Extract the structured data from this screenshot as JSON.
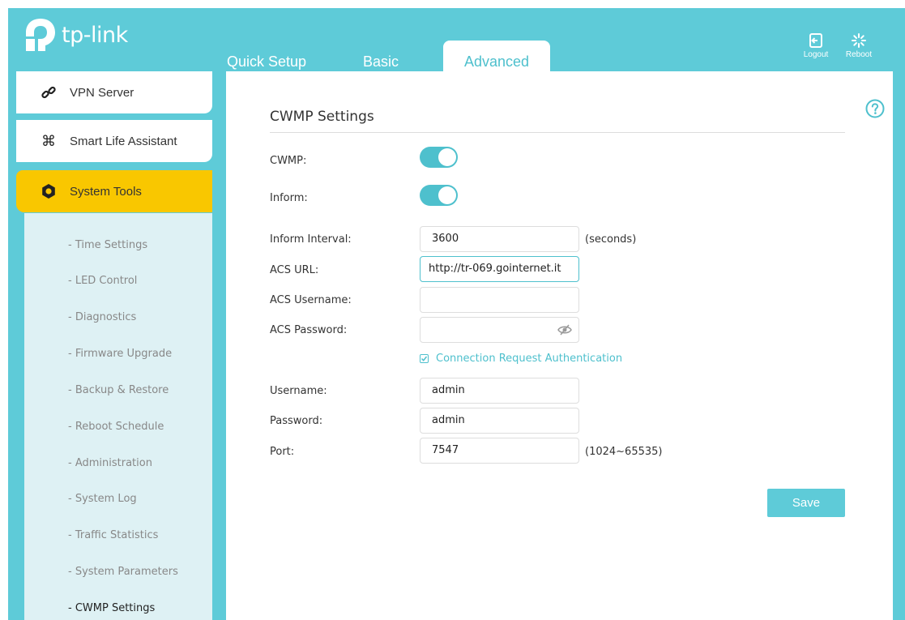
{
  "brand": {
    "name": "tp-link",
    "accent": "#4ec0cd",
    "header_bg": "#5ecbd8",
    "highlight": "#f9c700"
  },
  "header": {
    "tabs": [
      {
        "label": "Quick Setup",
        "active": false
      },
      {
        "label": "Basic",
        "active": false
      },
      {
        "label": "Advanced",
        "active": true
      }
    ],
    "logout_label": "Logout",
    "reboot_label": "Reboot"
  },
  "sidebar": {
    "items": [
      {
        "label": "VPN Server",
        "icon": "vpn-link-icon"
      },
      {
        "label": "Smart Life Assistant",
        "icon": "command-icon"
      },
      {
        "label": "System Tools",
        "icon": "gear-icon",
        "selected": true
      }
    ],
    "subitems": [
      {
        "label": "- Time Settings"
      },
      {
        "label": "- LED Control"
      },
      {
        "label": "- Diagnostics"
      },
      {
        "label": "- Firmware Upgrade"
      },
      {
        "label": "- Backup & Restore"
      },
      {
        "label": "- Reboot Schedule"
      },
      {
        "label": "- Administration"
      },
      {
        "label": "- System Log"
      },
      {
        "label": "- Traffic Statistics"
      },
      {
        "label": "- System Parameters"
      },
      {
        "label": "- CWMP Settings",
        "current": true
      }
    ]
  },
  "main": {
    "title": "CWMP Settings",
    "cwmp_label": "CWMP:",
    "cwmp_enabled": true,
    "inform_label": "Inform:",
    "inform_enabled": true,
    "inform_interval_label": "Inform Interval:",
    "inform_interval_value": "3600",
    "inform_interval_unit": "(seconds)",
    "acs_url_label": "ACS URL:",
    "acs_url_value": "http://tr-069.gointernet.it",
    "acs_username_label": "ACS Username:",
    "acs_username_value": "",
    "acs_password_label": "ACS Password:",
    "acs_password_value": "",
    "conn_req_auth_label": "Connection Request Authentication",
    "conn_req_auth_checked": true,
    "username_label": "Username:",
    "username_value": "admin",
    "password_label": "Password:",
    "password_value": "admin",
    "port_label": "Port:",
    "port_value": "7547",
    "port_range": "(1024~65535)",
    "save_label": "Save"
  }
}
